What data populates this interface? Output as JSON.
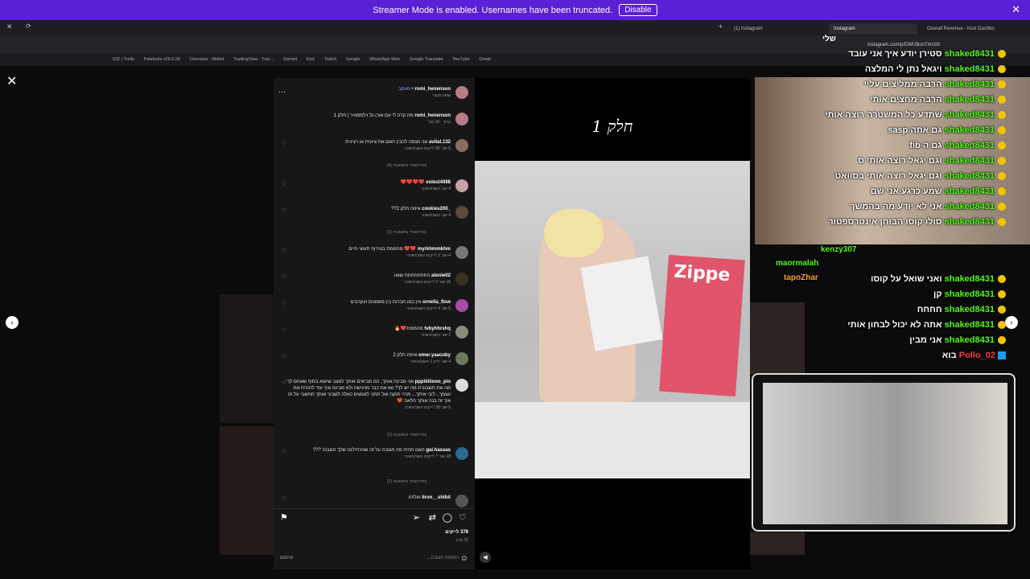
{
  "banner": {
    "text": "Streamer Mode is enabled. Usernames have been truncated.",
    "button": "Disable"
  },
  "tabs": [
    {
      "label": "(1) Instagram",
      "active": false
    },
    {
      "label": "Instagram",
      "active": true
    },
    {
      "label": "Overall Revenue - Kick Dashbo",
      "active": false
    }
  ],
  "address": "instagram.com/p/DWUBonTImX8/",
  "bookmarks": [
    "IOZ | Trello",
    "Paletools v26.0.28",
    "Overview - Wallet",
    "TradingView - Trac...",
    "Gemini",
    "Kick",
    "Twitch",
    "Google",
    "WhatsApp Web",
    "Google Translate",
    "YouTube",
    "Gmail",
    "SkyWay Tours"
  ],
  "post": {
    "header_user": "romi_henenson",
    "header_follow": "מעקב",
    "header_sub": "שמע מקורי",
    "caption_user": "romi_henenson",
    "caption_text": "מה קרה לי עם אורן גל וילמסוויר | חלק 1",
    "caption_meta": "ערוך · 10 שב'",
    "comments": [
      {
        "user": "avital.132",
        "text": "אני מנסה להבין האם את ציונית או רצינית",
        "meta": "5 שב' 90 לייקים השב/השיבי",
        "replies": "צפייה/צפיי בתשובות (4)"
      },
      {
        "user": "estest4988",
        "text": "❤️❤️❤️❤️",
        "meta": "4 שב' השב/השיבי",
        "replies": ""
      },
      {
        "user": "_cookies200",
        "text": "איפה חלק 2??",
        "meta": "4 שב' השב/השיבי",
        "replies": "צפייה/צפיי בתשובות (1)"
      },
      {
        "user": "myrkhmmkhm",
        "text": "❤️❤️ מהממת בטירוף תעשי חיים",
        "meta": "4 שב' 3 לייקים השב/השיבי",
        "replies": ""
      },
      {
        "user": "alonie02",
        "text": "החחחחחחח שאוו",
        "meta": "18 שב' 2 לייקים השב/השיבי",
        "replies": ""
      },
      {
        "user": "ornella_flow",
        "text": "אין כמו חברות בין מאמנים ועקרבים",
        "meta": "5 שב' 4 לייקים השב/השיבי",
        "replies": ""
      },
      {
        "user": "tvbyhhrshq",
        "text": "מהממת❤️🔥",
        "meta": "2 שב' השב/השיבי",
        "replies": ""
      },
      {
        "user": "omer.yaacoby",
        "text": "איפה חלק 2",
        "meta": "4 שב' לייק 1 השב/השיבי",
        "replies": ""
      },
      {
        "user": "pppiiiiiiooo_pio",
        "text": "אני מבינה אותך, הם מביאים אותך למצב שיוצא בסוף שאתם לך: מה את חשבונית מה יש לך? ואז את כבר מרגישה ולא מבינה איך עוד להוכיח את עצמך.. ליבי איתך... תהיי חזקה ואל תתני לאנשים כאלה לשבור אותך תחשבי על זה איך זה בנה אותך הלאה ❤️",
        "meta": "5 שב' 38 לייקים השב/השיבי",
        "replies": "צפייה/צפיי בתשובות (2)"
      },
      {
        "user": "gal.hassas",
        "text": "האם תהיה פה תגובה על זה שהרחילנה שלך המבוה ???",
        "meta": "18 שב' 7 לייקים השב/השיבי",
        "replies": "צפייה/צפיי בתשובות (1)"
      },
      {
        "user": "liron__shibit",
        "text": "ועליהו",
        "meta": "",
        "replies": ""
      }
    ],
    "likes": "378 לייקים",
    "date": "25 מרץ",
    "add_comment": "הוספת תגובה...",
    "publish": "פרסום",
    "video_title": "חלק 1",
    "magazine": "Zippe"
  },
  "chat": {
    "header": "שלי",
    "messages": [
      {
        "user": "shaked8431",
        "text": "סטירן יודע איך אני עובד"
      },
      {
        "user": "shaked8431",
        "text": "ויגאל נתן לי המלצה"
      },
      {
        "user": "shaked8431",
        "text": "הרבה ממליצים עליי"
      },
      {
        "user": "shaked8431",
        "text": "הרבה מחצים אותי"
      },
      {
        "user": "shaked8431",
        "text": "שתדע כל המשטרה רוצה אותי"
      },
      {
        "user": "shaked8431",
        "text": "גם אתה sasp"
      },
      {
        "user": "shaked8431",
        "text": "גם ה fib"
      },
      {
        "user": "shaked8431",
        "text": "וגם יגאל רוצה אותי ס"
      },
      {
        "user": "shaked8431",
        "text": "וגם יגאל רוצה אותי בסוואט"
      },
      {
        "user": "shaked8431",
        "text": "שמע כרגע אני שם"
      },
      {
        "user": "shaked8431",
        "text": "אני לא יודע מה בהמשך"
      },
      {
        "user": "shaked8431",
        "text": "סולו קוסו הבוחן אינטרספטור"
      },
      {
        "user": "shaked8431",
        "text": "ואני שואל על קוסו"
      },
      {
        "user": "shaked8431",
        "text": "קן"
      },
      {
        "user": "shaked8431",
        "text": "חחחח"
      },
      {
        "user": "shaked8431",
        "text": "אתה לא יכול לבחון אותי"
      },
      {
        "user": "shaked8431",
        "text": "אני מבין"
      },
      {
        "user": "Pollo_02",
        "text": "בוא"
      }
    ],
    "extra_users": [
      "kenzy307",
      "maormalah",
      "tapoZhar"
    ]
  }
}
